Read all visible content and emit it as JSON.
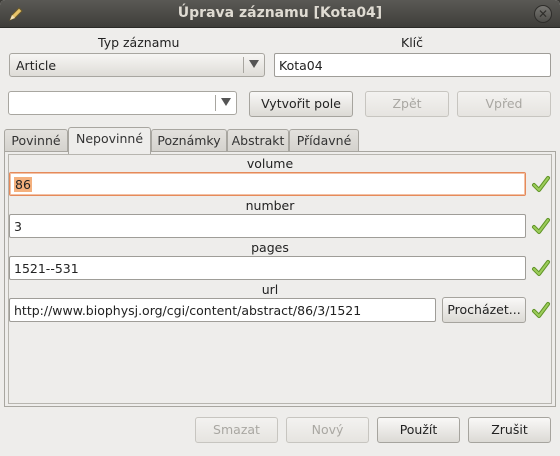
{
  "window": {
    "title": "Úprava záznamu [Kota04]",
    "app_icon": "pencil-icon",
    "close_icon": "close-icon"
  },
  "entry_type": {
    "label": "Typ záznamu",
    "value": "Article"
  },
  "key": {
    "label": "Klíč",
    "value": "Kota04"
  },
  "toolbar": {
    "field_combo_value": "",
    "create_field_label": "Vytvořit pole",
    "back_label": "Zpět",
    "forward_label": "Vpřed"
  },
  "tabs": [
    {
      "label": "Povinné",
      "active": false
    },
    {
      "label": "Nepovinné",
      "active": true
    },
    {
      "label": "Poznámky",
      "active": false
    },
    {
      "label": "Abstrakt",
      "active": false
    },
    {
      "label": "Přídavné",
      "active": false
    }
  ],
  "fields": {
    "volume": {
      "label": "volume",
      "value": "86",
      "valid": true
    },
    "number": {
      "label": "number",
      "value": "3",
      "valid": true
    },
    "pages": {
      "label": "pages",
      "value": "1521--531",
      "valid": true
    },
    "url": {
      "label": "url",
      "value": "http://www.biophysj.org/cgi/content/abstract/86/3/1521",
      "browse_label": "Procházet...",
      "valid": true
    }
  },
  "footer": {
    "delete_label": "Smazat",
    "new_label": "Nový",
    "apply_label": "Použít",
    "cancel_label": "Zrušit"
  },
  "colors": {
    "valid_check": "#7ab43a",
    "focus_border": "#e58a5a",
    "selection": "#f4b07d"
  }
}
